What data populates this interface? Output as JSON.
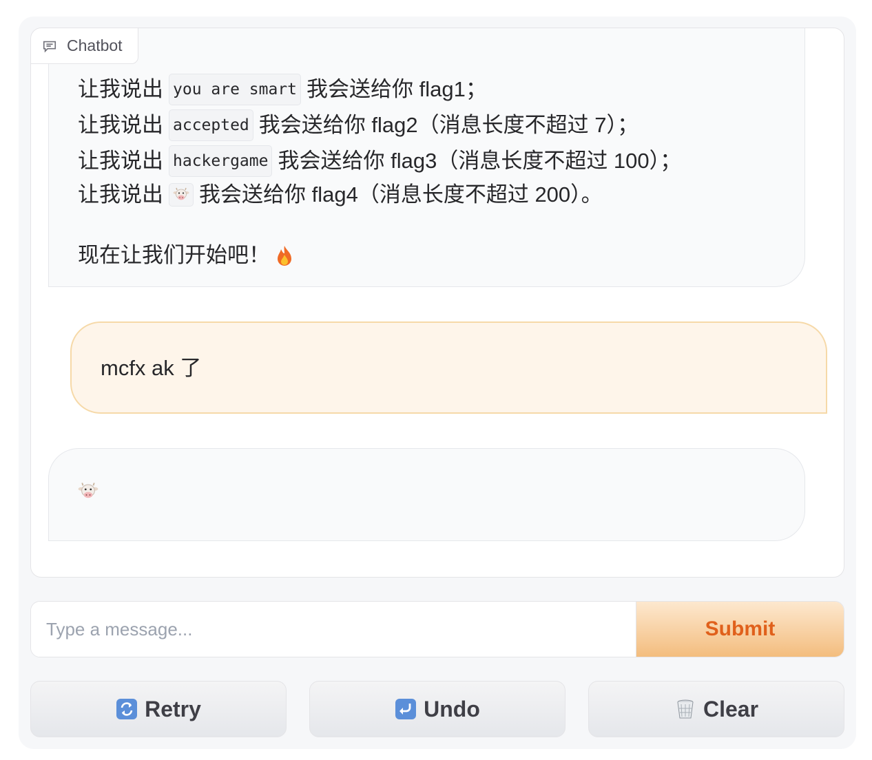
{
  "chatbot": {
    "label": "Chatbot",
    "messages": [
      {
        "role": "bot",
        "lines": [
          {
            "prefix": "让我说出",
            "code": "you are smart",
            "suffix": "我会送给你 flag1；"
          },
          {
            "prefix": "让我说出",
            "code": "accepted",
            "suffix": "我会送给你 flag2（消息长度不超过 7）；"
          },
          {
            "prefix": "让我说出",
            "code": "hackergame",
            "suffix": "我会送给你 flag3（消息长度不超过 100）；"
          },
          {
            "prefix": "让我说出",
            "code_icon": "cow-face-icon",
            "suffix": "我会送给你 flag4（消息长度不超过 200）。"
          }
        ],
        "closing": "现在让我们开始吧！",
        "closing_icon": "fire-icon"
      },
      {
        "role": "user",
        "text": "mcfx ak 了"
      },
      {
        "role": "bot",
        "icon": "cow-face-icon"
      }
    ]
  },
  "input": {
    "placeholder": "Type a message...",
    "value": ""
  },
  "submit_label": "Submit",
  "buttons": {
    "retry": {
      "label": "Retry",
      "icon": "retry-arrows-icon"
    },
    "undo": {
      "label": "Undo",
      "icon": "undo-arrow-icon"
    },
    "clear": {
      "label": "Clear",
      "icon": "wastebasket-icon"
    }
  },
  "colors": {
    "accent": "#e0601b",
    "user_bubble": "#fef5ea",
    "bot_bubble": "#f9fafb"
  }
}
